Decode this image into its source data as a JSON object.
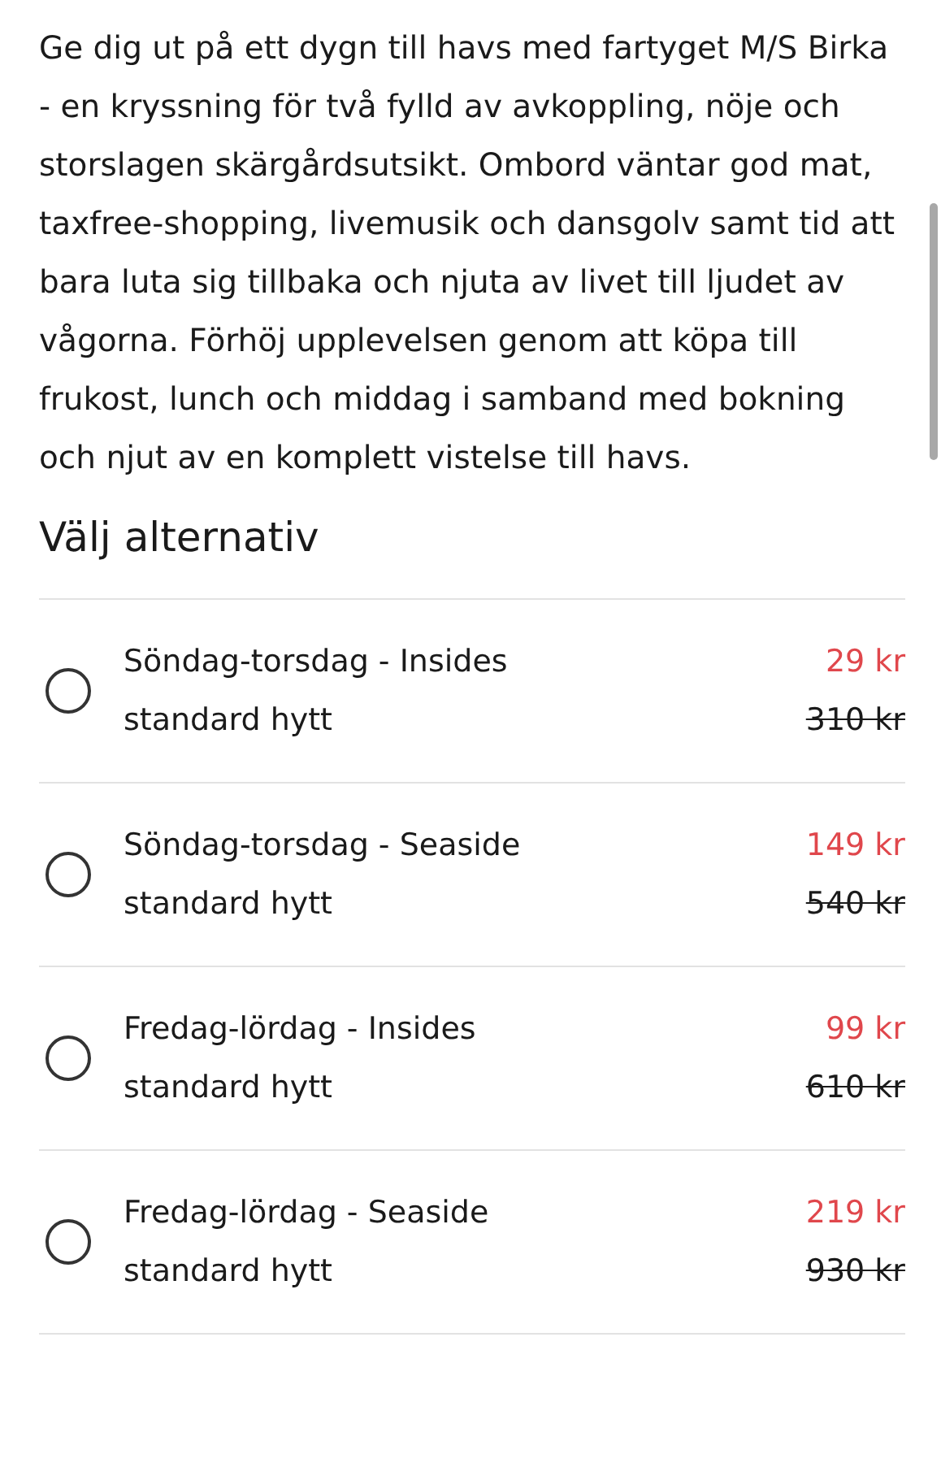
{
  "description": "Ge dig ut på ett dygn till havs med fartyget M/S Birka - en kryssning för två fylld av avkoppling, nöje och storslagen skärgårdsutsikt. Ombord väntar god mat, taxfree-shopping, livemusik och dansgolv samt tid att bara luta sig tillbaka och njuta av livet till ljudet av vågorna. Förhöj upplevelsen genom att köpa till frukost, lunch och middag i samband med bokning och njut av en komplett vistelse till havs.",
  "options_heading": "Välj alternativ",
  "options": [
    {
      "title": "Söndag-torsdag - Insides",
      "subtitle": "standard hytt",
      "price": "29 kr",
      "original_price": "310 kr",
      "selected": false
    },
    {
      "title": "Söndag-torsdag - Seaside",
      "subtitle": "standard hytt",
      "price": "149 kr",
      "original_price": "540 kr",
      "selected": false
    },
    {
      "title": "Fredag-lördag - Insides",
      "subtitle": "standard hytt",
      "price": "99 kr",
      "original_price": "610 kr",
      "selected": false
    },
    {
      "title": "Fredag-lördag - Seaside",
      "subtitle": "standard hytt",
      "price": "219 kr",
      "original_price": "930 kr",
      "selected": false
    }
  ]
}
